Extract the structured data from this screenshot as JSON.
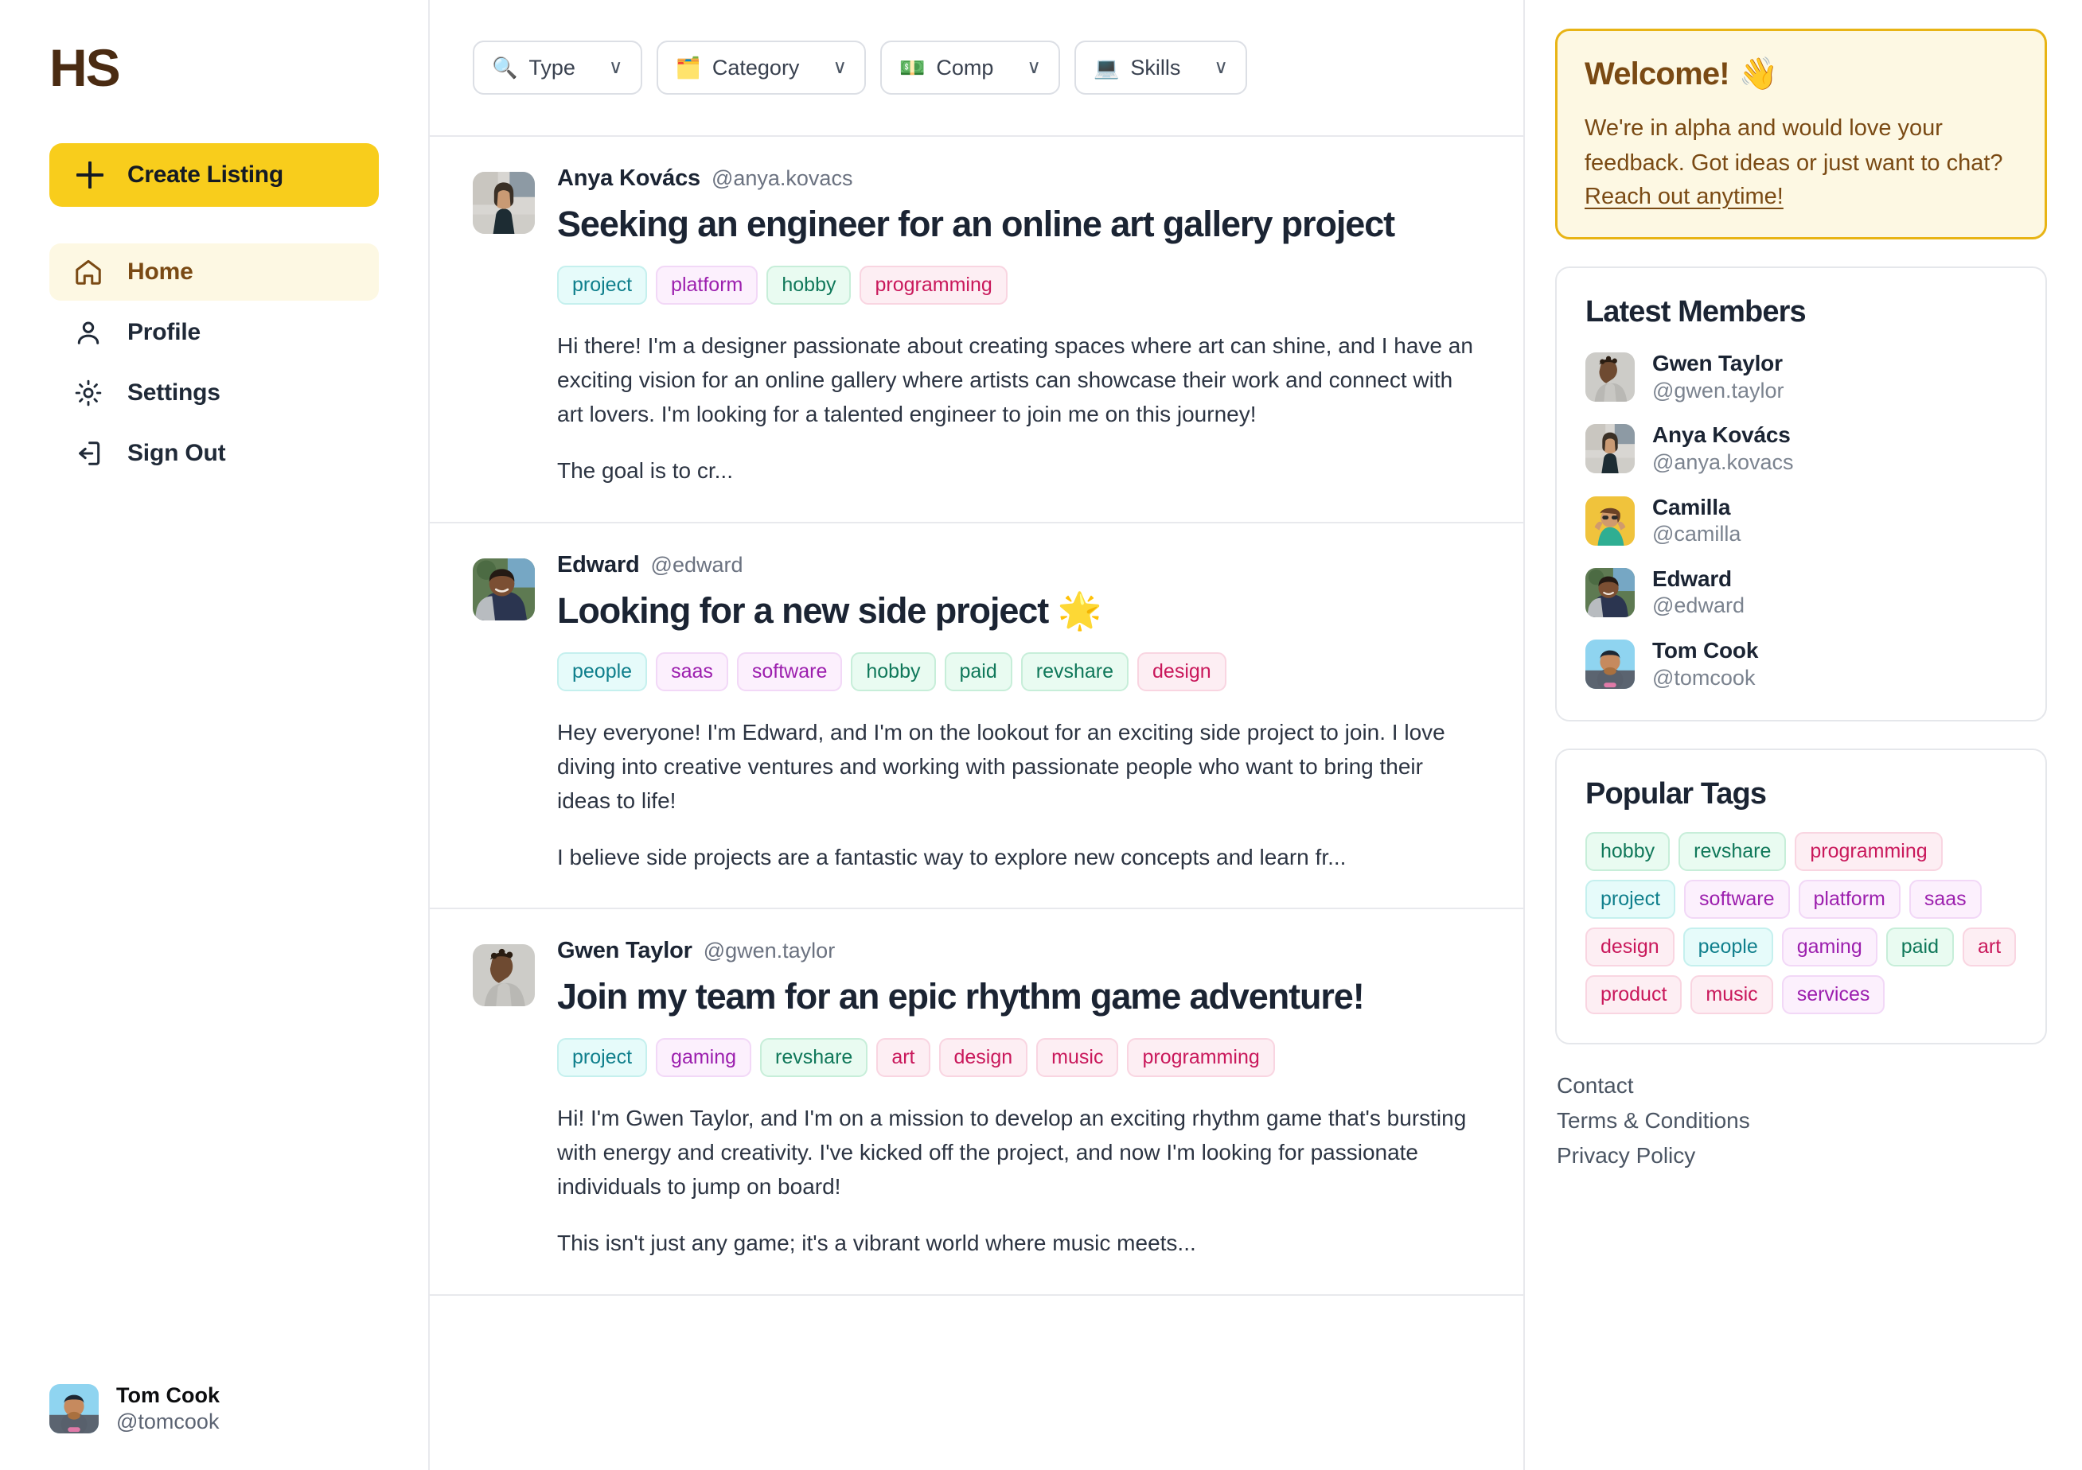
{
  "brand": {
    "logo_text": "HS"
  },
  "sidebar": {
    "create_listing_label": "Create Listing",
    "items": [
      {
        "label": "Home",
        "icon": "home-icon",
        "active": true
      },
      {
        "label": "Profile",
        "icon": "user-icon",
        "active": false
      },
      {
        "label": "Settings",
        "icon": "gear-icon",
        "active": false
      },
      {
        "label": "Sign Out",
        "icon": "sign-out-icon",
        "active": false
      }
    ],
    "current_user": {
      "name": "Tom Cook",
      "handle": "@tomcook"
    }
  },
  "filters": [
    {
      "emoji": "🔍",
      "label": "Type",
      "icon": "magnifier-icon",
      "caret": "∨"
    },
    {
      "emoji": "🗂️",
      "label": "Category",
      "icon": "folder-icon",
      "caret": "∨"
    },
    {
      "emoji": "💵",
      "label": "Comp",
      "icon": "money-icon",
      "caret": "∨"
    },
    {
      "emoji": "💻",
      "label": "Skills",
      "icon": "laptop-icon",
      "caret": "∨"
    }
  ],
  "posts": [
    {
      "author": "Anya Kovács",
      "handle": "@anya.kovacs",
      "title": "Seeking an engineer for an online art gallery project",
      "tags": [
        {
          "label": "project",
          "color": "c-teal"
        },
        {
          "label": "platform",
          "color": "c-purple"
        },
        {
          "label": "hobby",
          "color": "c-green"
        },
        {
          "label": "programming",
          "color": "c-pink"
        }
      ],
      "body": [
        "Hi there! I'm a designer passionate about creating spaces where art can shine, and I have an exciting vision for an online gallery where artists can showcase their work and connect with art lovers. I'm looking for a talented engineer to join me on this journey!",
        "The goal is to cr..."
      ]
    },
    {
      "author": "Edward",
      "handle": "@edward",
      "title": "Looking for a new side project 🌟",
      "tags": [
        {
          "label": "people",
          "color": "c-teal"
        },
        {
          "label": "saas",
          "color": "c-purple"
        },
        {
          "label": "software",
          "color": "c-purple"
        },
        {
          "label": "hobby",
          "color": "c-green"
        },
        {
          "label": "paid",
          "color": "c-green"
        },
        {
          "label": "revshare",
          "color": "c-green"
        },
        {
          "label": "design",
          "color": "c-pink"
        }
      ],
      "body": [
        "Hey everyone! I'm Edward, and I'm on the lookout for an exciting side project to join. I love diving into creative ventures and working with passionate people who want to bring their ideas to life!",
        "I believe side projects are a fantastic way to explore new concepts and learn fr..."
      ]
    },
    {
      "author": "Gwen Taylor",
      "handle": "@gwen.taylor",
      "title": "Join my team for an epic rhythm game adventure!",
      "tags": [
        {
          "label": "project",
          "color": "c-teal"
        },
        {
          "label": "gaming",
          "color": "c-purple"
        },
        {
          "label": "revshare",
          "color": "c-green"
        },
        {
          "label": "art",
          "color": "c-pink"
        },
        {
          "label": "design",
          "color": "c-pink"
        },
        {
          "label": "music",
          "color": "c-pink"
        },
        {
          "label": "programming",
          "color": "c-pink"
        }
      ],
      "body": [
        "Hi! I'm Gwen Taylor, and I'm on a mission to develop an exciting rhythm game that's bursting with energy and creativity. I've kicked off the project, and now I'm looking for passionate individuals to jump on board!",
        "This isn't just any game; it's a vibrant world where music meets..."
      ]
    }
  ],
  "welcome": {
    "heading": "Welcome!",
    "emoji": "👋",
    "body": "We're in alpha and would love your feedback. Got ideas or just want to chat?",
    "link": "Reach out anytime!"
  },
  "latest_members": {
    "title": "Latest Members",
    "items": [
      {
        "name": "Gwen Taylor",
        "handle": "@gwen.taylor"
      },
      {
        "name": "Anya Kovács",
        "handle": "@anya.kovacs"
      },
      {
        "name": "Camilla",
        "handle": "@camilla"
      },
      {
        "name": "Edward",
        "handle": "@edward"
      },
      {
        "name": "Tom Cook",
        "handle": "@tomcook"
      }
    ]
  },
  "popular_tags": {
    "title": "Popular Tags",
    "items": [
      {
        "label": "hobby",
        "color": "c-green"
      },
      {
        "label": "revshare",
        "color": "c-green"
      },
      {
        "label": "programming",
        "color": "c-pink"
      },
      {
        "label": "project",
        "color": "c-teal"
      },
      {
        "label": "software",
        "color": "c-purple"
      },
      {
        "label": "platform",
        "color": "c-purple"
      },
      {
        "label": "saas",
        "color": "c-purple"
      },
      {
        "label": "design",
        "color": "c-pink"
      },
      {
        "label": "people",
        "color": "c-teal"
      },
      {
        "label": "gaming",
        "color": "c-purple"
      },
      {
        "label": "paid",
        "color": "c-green"
      },
      {
        "label": "art",
        "color": "c-pink"
      },
      {
        "label": "product",
        "color": "c-pink"
      },
      {
        "label": "music",
        "color": "c-pink"
      },
      {
        "label": "services",
        "color": "c-purple"
      }
    ]
  },
  "footer": {
    "links": [
      "Contact",
      "Terms & Conditions",
      "Privacy Policy"
    ]
  },
  "colors": {
    "brand_yellow": "#f8cd1c",
    "brand_brown": "#7a4a14",
    "logo_brown": "#4a2b12",
    "welcome_bg": "#fdf8e3",
    "welcome_border": "#e8b415",
    "ink": "#1b2433",
    "muted": "#6b7280",
    "divider": "#e8e9ed"
  }
}
